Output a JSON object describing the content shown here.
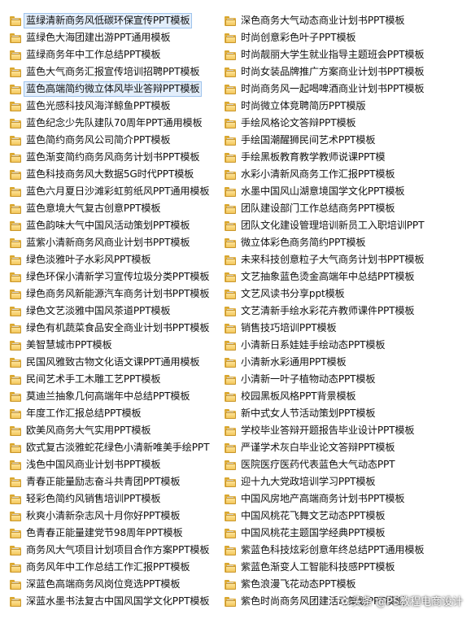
{
  "file_list": {
    "left_column": [
      "蓝绿清新商务风低碳环保宣传PPT模板",
      "蓝绿色大海团建出游PPT通用模板",
      "蓝绿商务年中工作总结PPT模板",
      "蓝色大气商务汇报宣传培训招聘PPT模板",
      "蓝色高端简约微立体风毕业答辩PPT模板",
      "蓝色光感科技风海洋鲸鱼PPT模板",
      "蓝色纪念少先队建队70周年PPT通用模板",
      "蓝色简约商务风公司简介PPT模板",
      "蓝色渐变简约商务风商务计划书PPT模板",
      "蓝色科技商务风大数据5G时代PPT模板",
      "蓝色六月夏日沙滩彩虹剪纸风PPT通用模板",
      "蓝色意境大气复古创意PPT模板",
      "蓝色韵味大气中国风活动策划PPT模板",
      "蓝紫小清新商务风商业计划书PPT模板",
      "绿色淡雅叶子水彩风PPT模板",
      "绿色环保小清新学习宣传垃圾分类PPT模板",
      "绿色商务风新能源汽车商务计划书PPT模板",
      "绿色文艺淡雅中国风茶道PPT模板",
      "绿色有机蔬菜食品安全商业计划书PPT模板",
      "美智慧城市PPT模板",
      "民国风雅致古物文化语文课PPT通用模板",
      "民间艺术手工木雕工艺PPT模板",
      "莫迪兰抽象几何高端年中总结PPT模板",
      "年度工作汇报总结PPT模板",
      "欧美风商务大气实用PPT模板",
      "欧式复古淡雅蛇花绿色小清新唯美手绘PPT",
      "浅色中国风商业计划书PPT模板",
      "青春正能量励志奋斗共青团PPT模板",
      "轻彩色简约风销售培训PPT模板",
      "秋爽小清新杂志风十月你好PPT模板",
      "色青春正能量建党节98周年PPT模板",
      "商务风大气项目计划项目合作方案PPT模板",
      "商务风年中工作总结工作汇报PPT模板",
      "深蓝色高端商务风岗位竞选PPT模板",
      "深蓝水墨书法复古中国风国学文化PPT模板"
    ],
    "right_column": [
      "深色商务大气动态商业计划书PPT模板",
      "时尚创意彩色叶子PPT模板",
      "时尚靓丽大学生就业指导主题班会PPT模板",
      "时尚女装品牌推广方案商业计划书PPT模板",
      "时尚商务风一起喝啤酒商业计划书PPT模板",
      "时尚微立体竞聘简历PPT模版",
      "手绘风格论文答辩PPT模板",
      "手绘国潮醒狮民间艺术PPT模板",
      "手绘黑板教育教学教师说课PPT模",
      "水彩小清新风商务工作汇报PPT模板",
      "水墨中国风山湖意境国学文化PPT模板",
      "团队建设部门工作总结商务PPT模板",
      "团队文化建设管理培训新员工入职培训PPT",
      "微立体彩色商务简约PPT模板",
      "未来科技创意粒子大气商务计划书PPT模板",
      "文艺抽象蓝色烫金高端年中总结PPT模板",
      "文艺风读书分享ppt模板",
      "文艺清新手绘水彩花卉教师课件PPT模板",
      "销售技巧培训PPT模板",
      "小清新日系娃娃手绘动态PPT模板",
      "小清新水彩通用PPT模板",
      "小清新一叶子植物动态PPT模板",
      "校园黑板风格PPT背景模板",
      "新中式女人节活动策划PPT模板",
      "学校毕业答辩开题报告毕业设计PPT模板",
      "严谨学术灰白毕业论文答辩PPT模板",
      "医院医疗医药代表蓝色大气动态PPT",
      "迎十九大党政培训学习PPT模板",
      "中国风房地产高端商务计划书PPT模板",
      "中国风桃花飞舞文艺动态PPT模板",
      "中国风桃花主题国学经典PPT模板",
      "紫蓝色科技炫彩创意年终总结PPT通用模板",
      "紫蓝色渐变人工智能科技感PPT模板",
      "紫色浪漫飞花动态PPT模板",
      "紫色时尚商务风团建活动策划PPT模板"
    ]
  },
  "watermark": {
    "text": "头条 @PS教程电商设计"
  },
  "icons": {
    "item_icon": "folder-icon"
  },
  "colors": {
    "folder_base": "#f3c75b",
    "folder_edge": "#c9962b",
    "selection": "#e3eefb"
  }
}
